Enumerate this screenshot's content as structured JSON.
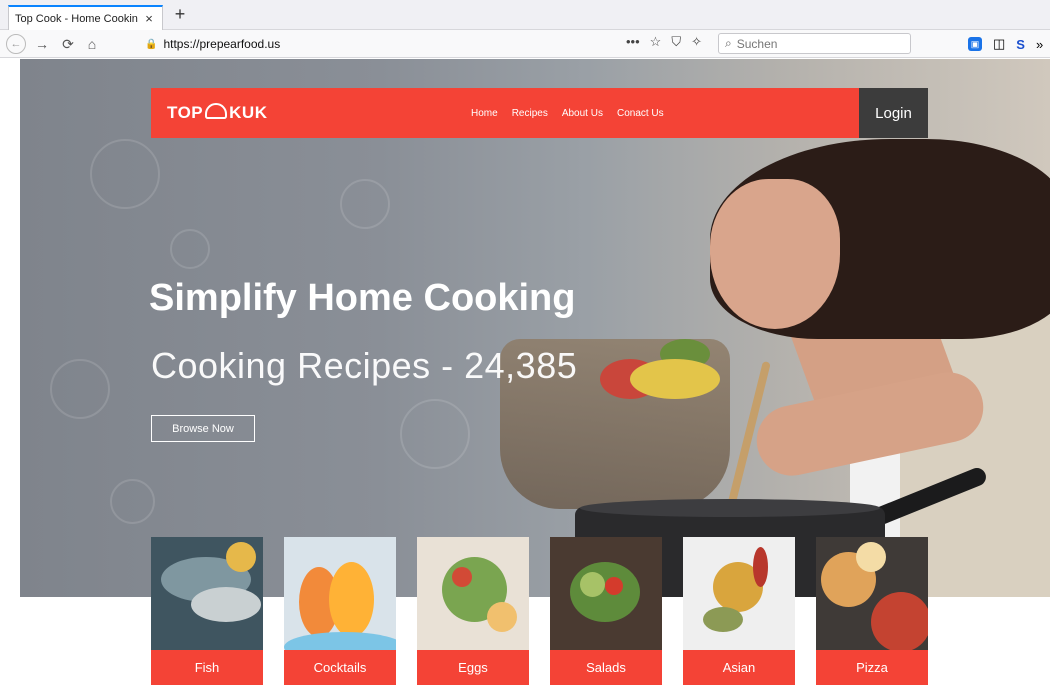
{
  "browser": {
    "tab_title": "Top Cook - Home Cookin",
    "tab_close": "×",
    "new_tab": "+",
    "url": "https://prepearfood.us",
    "search_placeholder": "Suchen",
    "url_actions": [
      "•••",
      "☆"
    ]
  },
  "site": {
    "logo_left": "TOP",
    "logo_right": "KUK",
    "nav": [
      "Home",
      "Recipes",
      "About Us",
      "Conact Us"
    ],
    "login": "Login"
  },
  "hero": {
    "headline": "Simplify Home Cooking",
    "subline": "Cooking Recipes - 24,385",
    "cta": "Browse Now"
  },
  "categories": [
    {
      "label": "Fish",
      "colors": [
        "#3f5560",
        "#7f97a0",
        "#c9d0d2",
        "#e6b84a"
      ]
    },
    {
      "label": "Cocktails",
      "colors": [
        "#d9e3ea",
        "#f28a3a",
        "#ffb236",
        "#7cc5e6"
      ]
    },
    {
      "label": "Eggs",
      "colors": [
        "#e9e1d6",
        "#7aa550",
        "#d24a36",
        "#f1c06e"
      ]
    },
    {
      "label": "Salads",
      "colors": [
        "#4a3a31",
        "#5e8b3b",
        "#d43b2c",
        "#a7c267"
      ]
    },
    {
      "label": "Asian",
      "colors": [
        "#efefef",
        "#d9a53d",
        "#b8372c",
        "#8c9a55"
      ]
    },
    {
      "label": "Pizza",
      "colors": [
        "#3f3a37",
        "#e0a35a",
        "#c44331",
        "#f4dca6"
      ]
    }
  ],
  "colors": {
    "brand_red": "#f44336",
    "login_dark": "#3c3c3c"
  }
}
